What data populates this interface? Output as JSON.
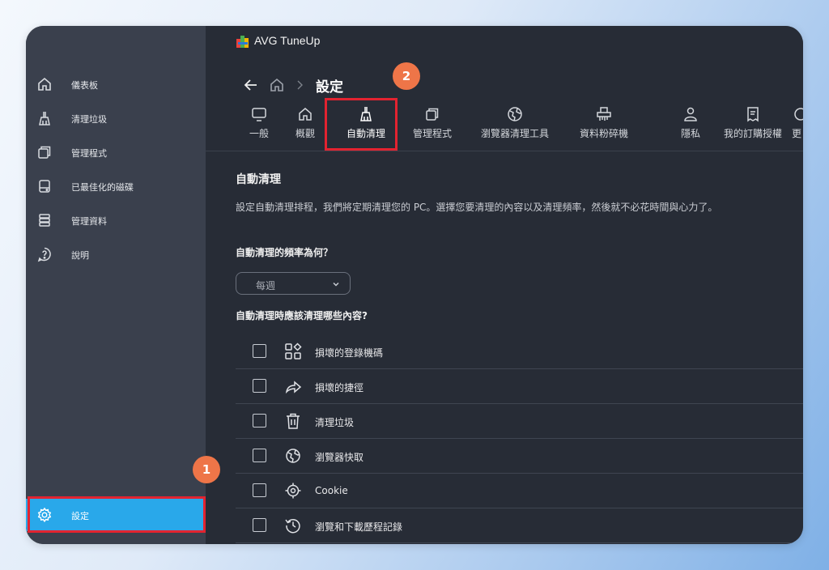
{
  "app": {
    "title": "AVG TuneUp"
  },
  "sidebar": {
    "items": [
      {
        "label": "儀表板",
        "icon": "home-icon"
      },
      {
        "label": "清理垃圾",
        "icon": "broom-icon"
      },
      {
        "label": "管理程式",
        "icon": "windows-icon"
      },
      {
        "label": "已最佳化的磁碟",
        "icon": "disk-icon"
      },
      {
        "label": "管理資料",
        "icon": "database-icon"
      },
      {
        "label": "說明",
        "icon": "help-icon"
      }
    ],
    "settings": {
      "label": "設定",
      "icon": "gear-icon"
    }
  },
  "header": {
    "page_title": "設定"
  },
  "tabs": [
    {
      "label": "一般",
      "icon": "monitor-icon"
    },
    {
      "label": "概觀",
      "icon": "home-icon"
    },
    {
      "label": "自動清理",
      "icon": "broom-icon",
      "active": true
    },
    {
      "label": "管理程式",
      "icon": "windows-icon"
    },
    {
      "label": "瀏覽器清理工具",
      "icon": "globe-icon"
    },
    {
      "label": "資料粉碎機",
      "icon": "shredder-icon"
    },
    {
      "label": "隱私",
      "icon": "person-icon"
    },
    {
      "label": "我的訂購授權",
      "icon": "receipt-icon"
    },
    {
      "label": "更",
      "icon": "more-icon"
    }
  ],
  "content": {
    "title": "自動清理",
    "description": "設定自動清理排程，我們將定期清理您的 PC。選擇您要清理的內容以及清理頻率，然後就不必花時間與心力了。",
    "frequency_question": "自動清理的頻率為何？",
    "frequency_value": "每週",
    "items_question": "自動清理時應該清理哪些內容?",
    "items": [
      {
        "label": "損壞的登錄機碼",
        "icon": "registry-icon",
        "checked": false
      },
      {
        "label": "損壞的捷徑",
        "icon": "shortcut-arrow-icon",
        "checked": false
      },
      {
        "label": "清理垃圾",
        "icon": "trash-icon",
        "checked": false
      },
      {
        "label": "瀏覽器快取",
        "icon": "globe-icon",
        "checked": false
      },
      {
        "label": "Cookie",
        "icon": "target-icon",
        "checked": false
      },
      {
        "label": "瀏覽和下載歷程記錄",
        "icon": "history-icon",
        "checked": false
      }
    ]
  },
  "annotations": {
    "badge1": "1",
    "badge2": "2"
  },
  "colors": {
    "accent": "#29a8ea",
    "highlight": "#e32330",
    "badge": "#ee7548"
  }
}
